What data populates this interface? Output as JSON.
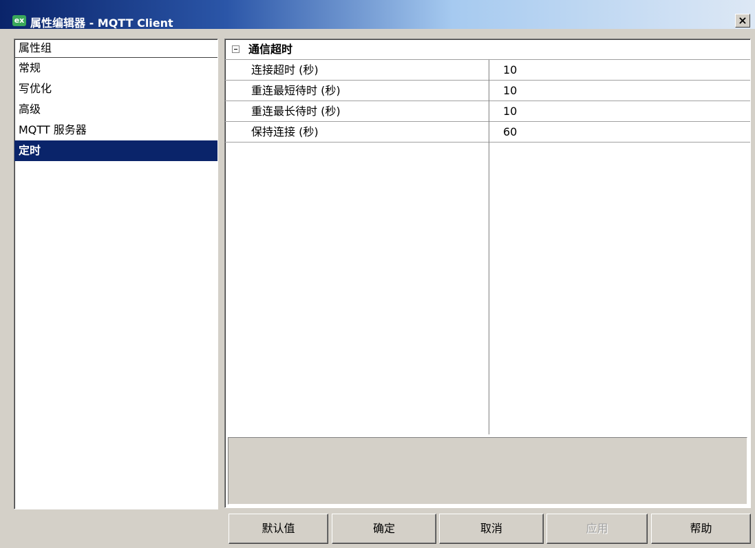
{
  "window": {
    "icon_text": "ex",
    "title": "属性编辑器 - MQTT Client",
    "close_label": "×"
  },
  "sidebar": {
    "header": "属性组",
    "items": [
      {
        "label": "常规",
        "selected": false
      },
      {
        "label": "写优化",
        "selected": false
      },
      {
        "label": "高级",
        "selected": false
      },
      {
        "label": "MQTT 服务器",
        "selected": false
      },
      {
        "label": "定时",
        "selected": true
      }
    ]
  },
  "properties": {
    "group_label": "通信超时",
    "rows": [
      {
        "name": "连接超时 (秒)",
        "value": "10"
      },
      {
        "name": "重连最短待时 (秒)",
        "value": "10"
      },
      {
        "name": "重连最长待时 (秒)",
        "value": "10"
      },
      {
        "name": "保持连接 (秒)",
        "value": "60"
      }
    ]
  },
  "buttons": {
    "default": "默认值",
    "ok": "确定",
    "cancel": "取消",
    "apply": "应用",
    "help": "帮助"
  }
}
